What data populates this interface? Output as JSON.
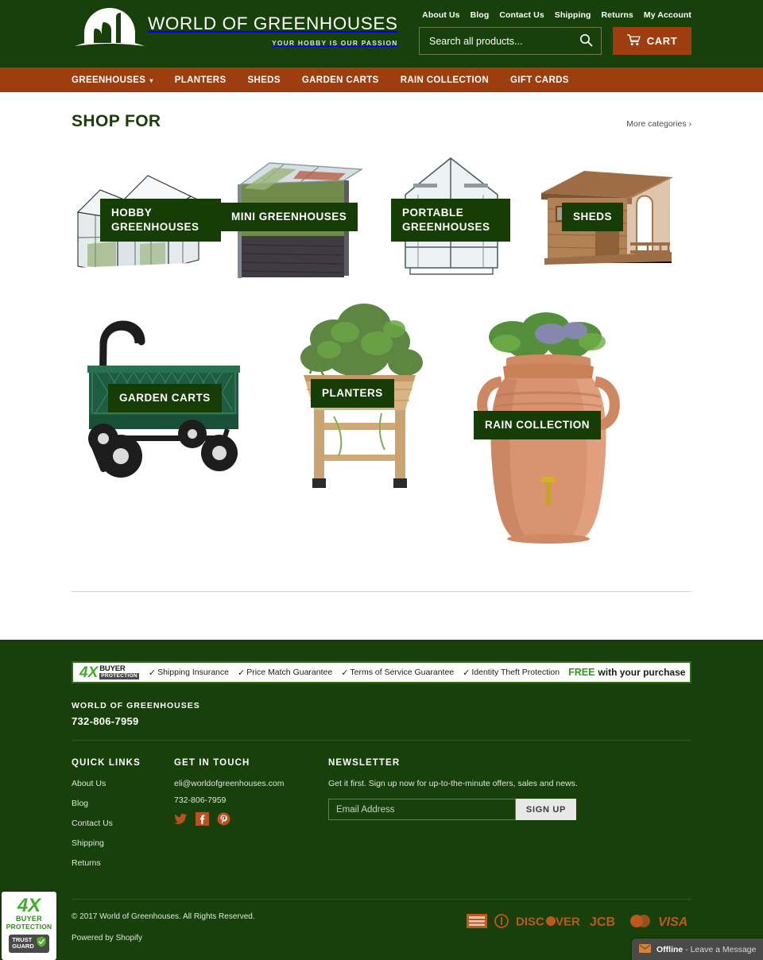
{
  "header": {
    "logo": {
      "title": "WORLD OF GREENHOUSES",
      "tagline": "YOUR HOBBY IS OUR PASSION",
      "icon": "greenhouse-dome-logo"
    },
    "top_links": [
      {
        "label": "About Us"
      },
      {
        "label": "Blog"
      },
      {
        "label": "Contact Us"
      },
      {
        "label": "Shipping"
      },
      {
        "label": "Returns"
      },
      {
        "label": "My Account"
      }
    ],
    "search": {
      "placeholder": "Search all products...",
      "value": "",
      "icon": "search-icon"
    },
    "cart": {
      "label": "CART",
      "icon": "shopping-cart-icon"
    },
    "colors": {
      "header_green": "#17400a",
      "nav_orange": "#9e3d10"
    }
  },
  "nav": {
    "items": [
      {
        "label": "GREENHOUSES",
        "has_dropdown": true
      },
      {
        "label": "PLANTERS",
        "has_dropdown": false
      },
      {
        "label": "SHEDS",
        "has_dropdown": false
      },
      {
        "label": "GARDEN CARTS",
        "has_dropdown": false
      },
      {
        "label": "RAIN COLLECTION",
        "has_dropdown": false
      },
      {
        "label": "GIFT CARDS",
        "has_dropdown": false
      }
    ]
  },
  "main": {
    "section_title": "SHOP FOR",
    "more_link": "More categories ›",
    "categories_row1": [
      {
        "label": "HOBBY GREENHOUSES",
        "art": "glass-hobby-greenhouse"
      },
      {
        "label": "MINI GREENHOUSES",
        "art": "mini-raised-greenhouse"
      },
      {
        "label": "PORTABLE GREENHOUSES",
        "art": "portable-plastic-greenhouse"
      },
      {
        "label": "SHEDS",
        "art": "wooden-shed"
      }
    ],
    "categories_row2": [
      {
        "label": "GARDEN CARTS",
        "art": "green-mesh-garden-cart"
      },
      {
        "label": "PLANTERS",
        "art": "wooden-raised-planter"
      },
      {
        "label": "RAIN COLLECTION",
        "art": "terracotta-rain-barrel"
      }
    ]
  },
  "footer": {
    "protection": {
      "logo_4x": "4X",
      "logo_buyer": "BUYER",
      "logo_protection": "PROTECTION",
      "items": [
        "Shipping Insurance",
        "Price Match Guarantee",
        "Terms of Service Guarantee",
        "Identity Theft Protection"
      ],
      "free_word": "FREE",
      "free_rest": "with your purchase"
    },
    "store": {
      "name": "WORLD OF GREENHOUSES",
      "phone": "732-806-7959"
    },
    "quick_links": {
      "title": "QUICK LINKS",
      "items": [
        "About Us",
        "Blog",
        "Contact Us",
        "Shipping",
        "Returns"
      ]
    },
    "get_in_touch": {
      "title": "GET IN TOUCH",
      "email": "eli@worldofgreenhouses.com",
      "phone": "732-806-7959",
      "socials": [
        "twitter-icon",
        "facebook-icon",
        "pinterest-icon"
      ]
    },
    "newsletter": {
      "title": "NEWSLETTER",
      "description": "Get it first. Sign up now for up-to-the-minute offers, sales and news.",
      "placeholder": "Email Address",
      "value": "",
      "button": "SIGN UP"
    },
    "copyright": "© 2017 World of Greenhouses. All Rights Reserved.",
    "powered_prefix": "Powered by ",
    "powered_link": "Shopify",
    "payments": [
      "american-express-icon",
      "diners-club-icon",
      "discover-icon",
      "jcb-icon",
      "mastercard-icon",
      "visa-icon"
    ]
  },
  "trust_badge": {
    "logo_4x": "4X",
    "buyer": "BUYER",
    "protection": "PROTECTION",
    "guard_top": "TRUST",
    "guard_bottom": "GUARD"
  },
  "chat": {
    "status": "Offline",
    "message": " - Leave a Message",
    "icon": "envelope-icon"
  }
}
